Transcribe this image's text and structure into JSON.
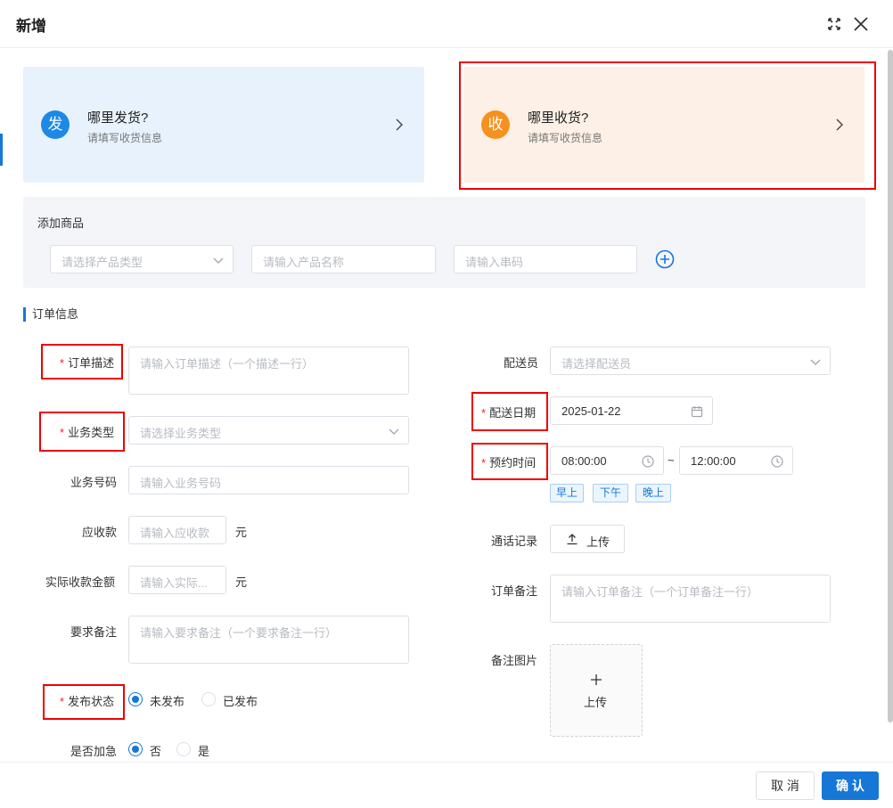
{
  "dialog": {
    "title": "新增"
  },
  "send_card": {
    "badge": "发",
    "title": "哪里发货?",
    "subtitle": "请填写收货信息",
    "badge_color": "#1e88e5"
  },
  "recv_card": {
    "badge": "收",
    "title": "哪里收货?",
    "subtitle": "请填写收货信息",
    "badge_color": "#f5911f"
  },
  "goods": {
    "label": "添加商品",
    "product_type_placeholder": "请选择产品类型",
    "product_name_placeholder": "请输入产品名称",
    "serial_placeholder": "请输入串码"
  },
  "section": {
    "title": "订单信息"
  },
  "left": {
    "desc": {
      "required": "*",
      "label": "订单描述",
      "placeholder": "请输入订单描述（一个描述一行）"
    },
    "biz_type": {
      "required": "*",
      "label": "业务类型",
      "placeholder": "请选择业务类型"
    },
    "biz_no": {
      "label": "业务号码",
      "placeholder": "请输入业务号码"
    },
    "receivable": {
      "label": "应收款",
      "placeholder": "请输入应收款",
      "unit": "元"
    },
    "actual": {
      "label": "实际收款金额",
      "placeholder": "请输入实际...",
      "unit": "元"
    },
    "remark": {
      "label": "要求备注",
      "placeholder": "请输入要求备注（一个要求备注一行）"
    },
    "publish": {
      "required": "*",
      "label": "发布状态",
      "options": [
        "未发布",
        "已发布"
      ],
      "selected": "未发布"
    },
    "urgent": {
      "label": "是否加急",
      "options": [
        "否",
        "是"
      ],
      "selected": "否"
    }
  },
  "right": {
    "courier": {
      "label": "配送员",
      "placeholder": "请选择配送员"
    },
    "date": {
      "required": "*",
      "label": "配送日期",
      "value": "2025-01-22"
    },
    "time": {
      "required": "*",
      "label": "预约时间",
      "start": "08:00:00",
      "sep": "~",
      "end": "12:00:00",
      "tags": [
        "早上",
        "下午",
        "晚上"
      ]
    },
    "call_log": {
      "label": "通话记录",
      "button": "上传"
    },
    "order_remark": {
      "label": "订单备注",
      "placeholder": "请输入订单备注（一个订单备注一行）"
    },
    "image": {
      "label": "备注图片",
      "button": "上传"
    }
  },
  "footer": {
    "cancel": "取 消",
    "ok": "确 认"
  },
  "colors": {
    "primary": "#1677d6",
    "highlight": "#e00000",
    "required": "#e23333"
  }
}
